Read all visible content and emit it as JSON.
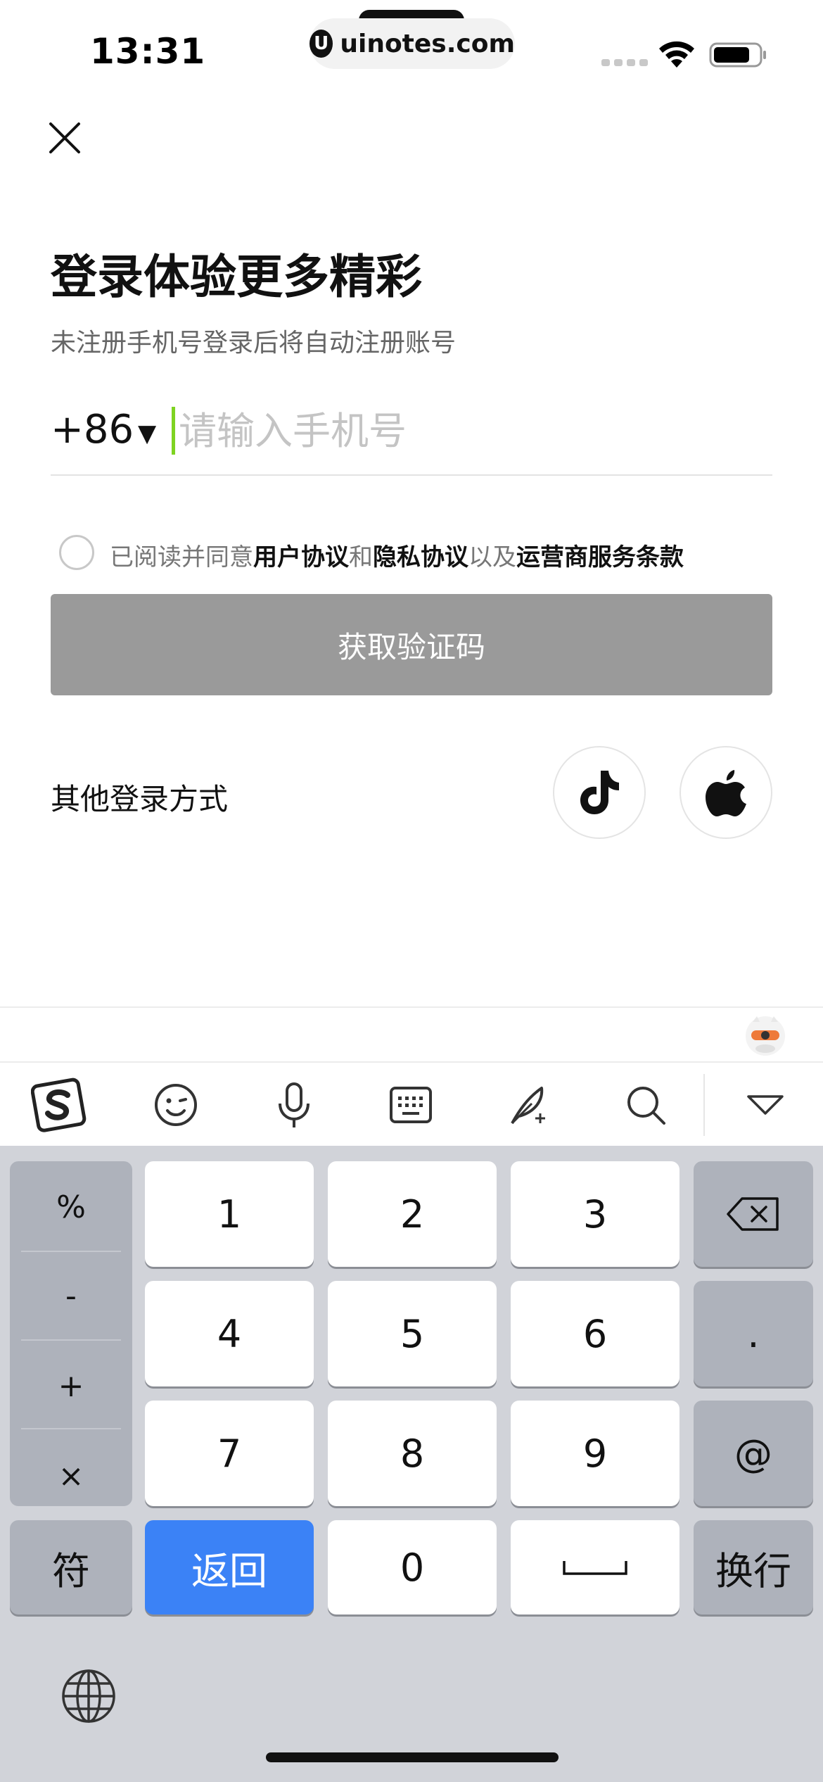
{
  "status_bar": {
    "time": "13:31",
    "url": "uinotes.com",
    "url_logo": "U"
  },
  "login": {
    "title": "登录体验更多精彩",
    "subtitle": "未注册手机号登录后将自动注册账号",
    "country_code": "+86",
    "country_arrow": "▼",
    "phone_placeholder": "请输入手机号",
    "agreement": {
      "prefix": "已阅读并同意",
      "user_agreement": "用户协议",
      "and": "和",
      "privacy_agreement": "隐私协议",
      "also": "以及",
      "carrier_terms": "运营商服务条款"
    },
    "get_code_label": "获取验证码",
    "other_login_label": "其他登录方式"
  },
  "keyboard": {
    "symbols": [
      "%",
      "-",
      "+",
      "×"
    ],
    "digits": [
      "1",
      "2",
      "3",
      "4",
      "5",
      "6",
      "7",
      "8",
      "9",
      "0"
    ],
    "dot": ".",
    "at": "@",
    "symbol_switch": "符",
    "back": "返回",
    "newline": "换行"
  },
  "colors": {
    "accent_caret": "#7ed321",
    "button_disabled": "#9a9a9a",
    "keyboard_bg": "#d1d3d9",
    "blue_key": "#3b82f6"
  }
}
